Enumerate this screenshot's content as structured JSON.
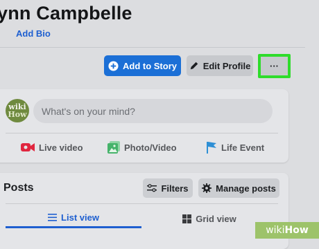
{
  "profile": {
    "name": "ynn Campbelle",
    "add_bio": "Add Bio"
  },
  "actions": {
    "add_to_story": "Add to Story",
    "edit_profile": "Edit Profile",
    "more": "···"
  },
  "composer": {
    "avatar_line1": "wiki",
    "avatar_line2": "How",
    "placeholder": "What's on your mind?",
    "live_video": "Live video",
    "photo_video": "Photo/Video",
    "life_event": "Life Event"
  },
  "posts": {
    "title": "Posts",
    "filters": "Filters",
    "manage_posts": "Manage posts",
    "list_view": "List view",
    "grid_view": "Grid view"
  },
  "watermark": {
    "wiki": "wiki",
    "how": "How"
  },
  "colors": {
    "accent": "#1b6fd6",
    "highlight": "#2edc2b",
    "live_red": "#e0263f",
    "photo_green": "#45b36a",
    "flag_blue": "#2d8fd5"
  }
}
